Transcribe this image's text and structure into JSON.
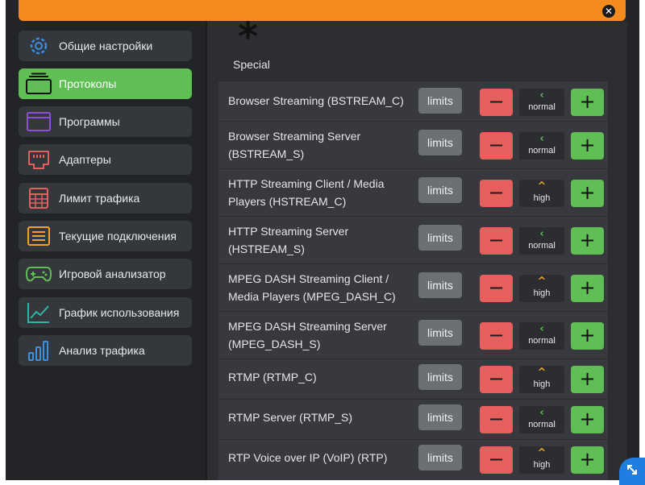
{
  "window": {
    "close_glyph": "✕"
  },
  "sidebar": {
    "items": [
      {
        "label": "Общие настройки",
        "icon": "gear-icon",
        "active": false
      },
      {
        "label": "Протоколы",
        "icon": "window-stack-icon",
        "active": true
      },
      {
        "label": "Программы",
        "icon": "app-window-icon",
        "active": false
      },
      {
        "label": "Адаптеры",
        "icon": "network-port-icon",
        "active": false
      },
      {
        "label": "Лимит трафика",
        "icon": "calculator-icon",
        "active": false
      },
      {
        "label": "Текущие подключения",
        "icon": "list-icon",
        "active": false
      },
      {
        "label": "Игровой анализатор",
        "icon": "gamepad-icon",
        "active": false
      },
      {
        "label": "График использования",
        "icon": "line-chart-icon",
        "active": false
      },
      {
        "label": "Анализ трафика",
        "icon": "bar-chart-icon",
        "active": false
      }
    ]
  },
  "main": {
    "category": {
      "symbol": "*",
      "label": "Special"
    },
    "limits_label": "limits",
    "minus_glyph": "−",
    "plus_glyph": "+",
    "protocols": [
      {
        "name": "Browser Streaming (BSTREAM_C)",
        "priority": "normal",
        "arrow": "‹"
      },
      {
        "name": "Browser Streaming Server (BSTREAM_S)",
        "priority": "normal",
        "arrow": "‹"
      },
      {
        "name": "HTTP Streaming Client / Media Players (HSTREAM_C)",
        "priority": "high",
        "arrow": "^"
      },
      {
        "name": "HTTP Streaming Server (HSTREAM_S)",
        "priority": "normal",
        "arrow": "‹"
      },
      {
        "name": "MPEG DASH Streaming Client / Media Players (MPEG_DASH_C)",
        "priority": "high",
        "arrow": "^"
      },
      {
        "name": "MPEG DASH Streaming Server (MPEG_DASH_S)",
        "priority": "normal",
        "arrow": "‹"
      },
      {
        "name": "RTMP (RTMP_C)",
        "priority": "high",
        "arrow": "^"
      },
      {
        "name": "RTMP Server (RTMP_S)",
        "priority": "normal",
        "arrow": "‹"
      },
      {
        "name": "RTP Voice over IP (VoIP) (RTP)",
        "priority": "high",
        "arrow": "^"
      }
    ]
  },
  "colors": {
    "accent_orange": "#f48b1f",
    "active_green": "#5fbf55",
    "minus_red": "#e65f5c",
    "high_arrow": "#f0a326"
  }
}
